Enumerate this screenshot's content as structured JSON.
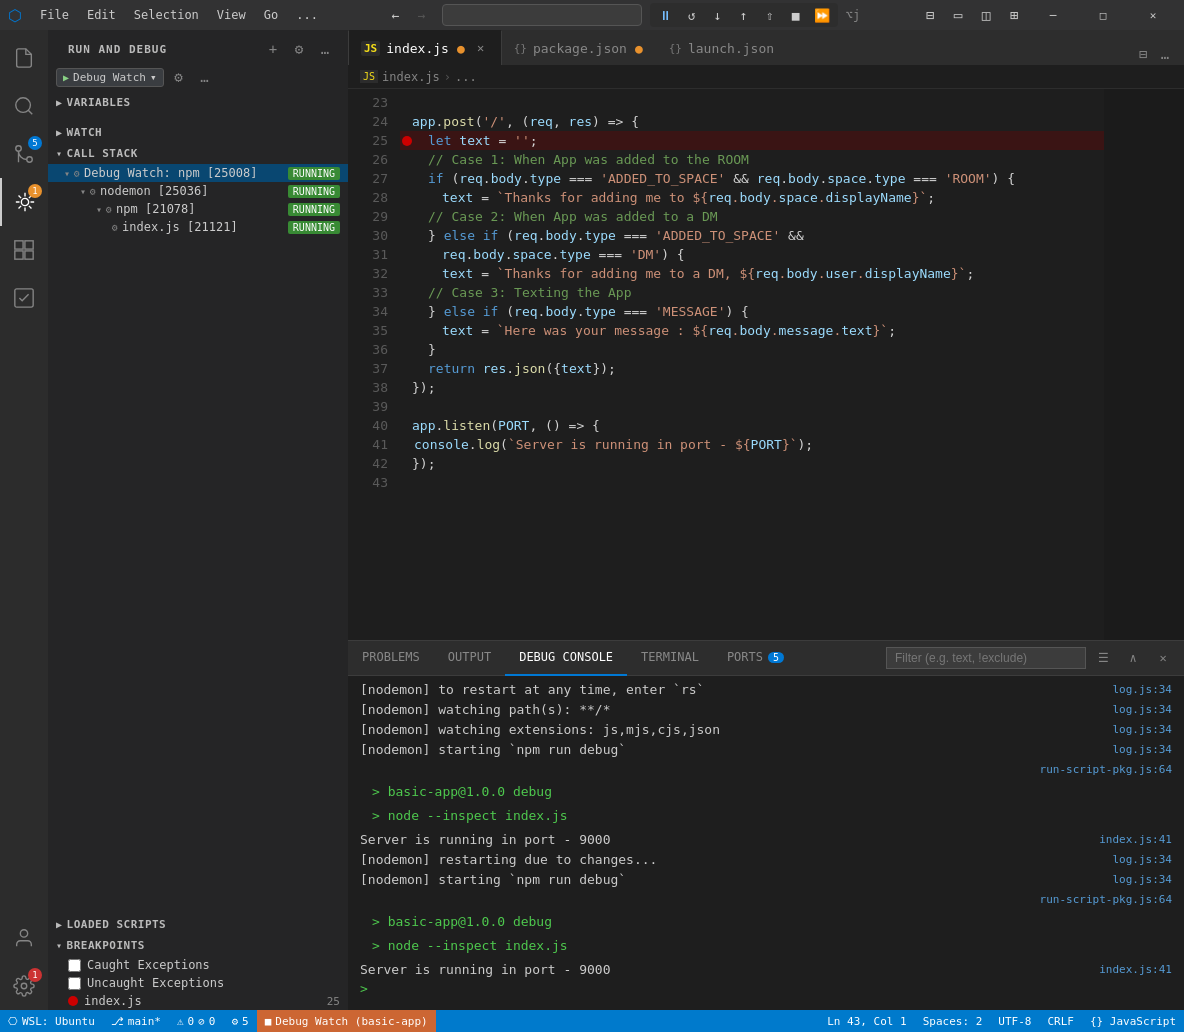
{
  "titlebar": {
    "menu_items": [
      "File",
      "Edit",
      "Selection",
      "View",
      "Go",
      "..."
    ],
    "search_placeholder": "",
    "window_buttons": [
      "─",
      "□",
      "✕"
    ],
    "debug_controls": [
      "⏸",
      "↻",
      "↓",
      "↑",
      "↺",
      "⬛",
      "⏩"
    ]
  },
  "activity_bar": {
    "icons": [
      {
        "name": "explorer",
        "symbol": "⎘",
        "active": false
      },
      {
        "name": "search",
        "symbol": "🔍",
        "active": false
      },
      {
        "name": "source-control",
        "symbol": "⎇",
        "badge": "5",
        "badge_color": "blue"
      },
      {
        "name": "debug",
        "symbol": "🐛",
        "active": true,
        "badge": "1",
        "badge_color": "orange"
      },
      {
        "name": "extensions",
        "symbol": "⊞",
        "active": false
      },
      {
        "name": "remote-explorer",
        "symbol": "⧉",
        "active": false
      }
    ],
    "bottom_icons": [
      {
        "name": "accounts",
        "symbol": "👤"
      },
      {
        "name": "settings",
        "symbol": "⚙",
        "badge": "1",
        "badge_color": "red"
      }
    ]
  },
  "sidebar": {
    "title": "RUN AND DEBUG",
    "debug_config": "Debug Watch",
    "sections": {
      "variables": {
        "label": "VARIABLES",
        "expanded": false
      },
      "watch": {
        "label": "WATCH",
        "expanded": false
      },
      "call_stack": {
        "label": "CALL STACK",
        "expanded": true,
        "items": [
          {
            "label": "Debug Watch: npm [25008]",
            "status": "RUNNING",
            "selected": true,
            "children": [
              {
                "label": "nodemon [25036]",
                "status": "RUNNING",
                "children": [
                  {
                    "label": "npm [21078]",
                    "status": "RUNNING",
                    "children": [
                      {
                        "label": "index.js [21121]",
                        "status": "RUNNING"
                      }
                    ]
                  }
                ]
              }
            ]
          }
        ]
      },
      "loaded_scripts": {
        "label": "LOADED SCRIPTS",
        "expanded": false
      },
      "breakpoints": {
        "label": "BREAKPOINTS",
        "expanded": true,
        "items": [
          {
            "label": "Caught Exceptions",
            "checked": false
          },
          {
            "label": "Uncaught Exceptions",
            "checked": false
          },
          {
            "label": "index.js",
            "checked": true,
            "has_dot": true,
            "line": "25"
          }
        ]
      }
    }
  },
  "editor": {
    "tabs": [
      {
        "label": "index.js",
        "type": "js",
        "active": true,
        "modified": true,
        "closeable": true
      },
      {
        "label": "package.json",
        "type": "json",
        "active": false,
        "modified": true,
        "closeable": false
      },
      {
        "label": "launch.json",
        "type": "json",
        "active": false,
        "modified": false,
        "closeable": false
      }
    ],
    "breadcrumb": [
      "JS index.js",
      ">",
      "..."
    ],
    "lines": [
      {
        "num": "23",
        "code": "",
        "class": ""
      },
      {
        "num": "24",
        "html": "<span class='c-variable'>app</span><span class='c-plain'>.</span><span class='c-function'>post</span><span class='c-plain'>(</span><span class='c-string'>'/'</span><span class='c-plain'>, (</span><span class='c-variable'>req</span><span class='c-plain'>, </span><span class='c-variable'>res</span><span class='c-plain'>) =&gt; {</span>"
      },
      {
        "num": "25",
        "html": "  <span class='c-keyword'>let</span> <span class='c-variable'>text</span> <span class='c-operator'>=</span> <span class='c-string'>''</span><span class='c-plain'>;</span>",
        "breakpoint": true
      },
      {
        "num": "26",
        "html": "    <span class='c-comment'>// Case 1: When App was added to the ROOM</span>"
      },
      {
        "num": "27",
        "html": "    <span class='c-keyword'>if</span> <span class='c-plain'>(</span><span class='c-variable'>req</span><span class='c-plain'>.</span><span class='c-prop'>body</span><span class='c-plain'>.</span><span class='c-prop'>type</span> <span class='c-operator'>===</span> <span class='c-string'>'ADDED_TO_SPACE'</span> <span class='c-operator'>&amp;&amp;</span> <span class='c-variable'>req</span><span class='c-plain'>.</span><span class='c-prop'>body</span><span class='c-plain'>.</span><span class='c-prop'>space</span><span class='c-plain'>.</span><span class='c-prop'>type</span> <span class='c-operator'>===</span> <span class='c-string'>'ROOM'</span><span class='c-plain'>) {</span>"
      },
      {
        "num": "28",
        "html": "      <span class='c-variable'>text</span> <span class='c-operator'>=</span> <span class='c-template'>`Thanks for adding me to $&#123;<span class='c-variable'>req</span>.<span class='c-prop'>body</span>.<span class='c-prop'>space</span>.<span class='c-prop'>displayName</span>&#125;`</span><span class='c-plain'>;</span>"
      },
      {
        "num": "29",
        "html": "    <span class='c-comment'>// Case 2: When App was added to a DM</span>"
      },
      {
        "num": "30",
        "html": "    <span class='c-plain'>&#125; </span><span class='c-keyword'>else if</span> <span class='c-plain'>(</span><span class='c-variable'>req</span><span class='c-plain'>.</span><span class='c-prop'>body</span><span class='c-plain'>.</span><span class='c-prop'>type</span> <span class='c-operator'>===</span> <span class='c-string'>'ADDED_TO_SPACE'</span> <span class='c-operator'>&amp;&amp;</span>"
      },
      {
        "num": "31",
        "html": "      <span class='c-variable'>req</span><span class='c-plain'>.</span><span class='c-prop'>body</span><span class='c-plain'>.</span><span class='c-prop'>space</span><span class='c-plain'>.</span><span class='c-prop'>type</span> <span class='c-operator'>===</span> <span class='c-string'>'DM'</span><span class='c-plain'>) {</span>"
      },
      {
        "num": "32",
        "html": "      <span class='c-variable'>text</span> <span class='c-operator'>=</span> <span class='c-template'>`Thanks for adding me to a DM, $&#123;<span class='c-variable'>req</span>.<span class='c-prop'>body</span>.<span class='c-prop'>user</span>.<span class='c-prop'>displayName</span>&#125;`</span><span class='c-plain'>;</span>"
      },
      {
        "num": "33",
        "html": "    <span class='c-comment'>// Case 3: Texting the App</span>"
      },
      {
        "num": "34",
        "html": "    <span class='c-plain'>&#125; </span><span class='c-keyword'>else if</span> <span class='c-plain'>(</span><span class='c-variable'>req</span><span class='c-plain'>.</span><span class='c-prop'>body</span><span class='c-plain'>.</span><span class='c-prop'>type</span> <span class='c-operator'>===</span> <span class='c-string'>'MESSAGE'</span><span class='c-plain'>) {</span>"
      },
      {
        "num": "35",
        "html": "      <span class='c-variable'>text</span> <span class='c-operator'>=</span> <span class='c-template'>`Here was your message : $&#123;<span class='c-variable'>req</span>.<span class='c-prop'>body</span>.<span class='c-prop'>message</span>.<span class='c-prop'>text</span>&#125;`</span><span class='c-plain'>;</span>"
      },
      {
        "num": "36",
        "html": "    <span class='c-plain'>&#125;</span>"
      },
      {
        "num": "37",
        "html": "    <span class='c-keyword'>return</span> <span class='c-variable'>res</span><span class='c-plain'>.</span><span class='c-function'>json</span><span class='c-plain'>(&#123;</span><span class='c-variable'>text</span><span class='c-plain'>&#125;);</span>"
      },
      {
        "num": "38",
        "html": "<span class='c-plain'>&#125;);</span>"
      },
      {
        "num": "39",
        "html": ""
      },
      {
        "num": "40",
        "html": "<span class='c-variable'>app</span><span class='c-plain'>.</span><span class='c-function'>listen</span><span class='c-plain'>(</span><span class='c-variable'>PORT</span><span class='c-plain'>, () =&gt; {</span>"
      },
      {
        "num": "41",
        "html": "  <span class='c-variable'>console</span><span class='c-plain'>.</span><span class='c-function'>log</span><span class='c-plain'>(</span><span class='c-template'>`Server is running in port - $&#123;<span class='c-variable'>PORT</span>&#125;`</span><span class='c-plain'>);</span>"
      },
      {
        "num": "42",
        "html": "<span class='c-plain'>&#125;);</span>"
      },
      {
        "num": "43",
        "html": ""
      }
    ]
  },
  "bottom_panel": {
    "tabs": [
      "PROBLEMS",
      "OUTPUT",
      "DEBUG CONSOLE",
      "TERMINAL",
      "PORTS"
    ],
    "active_tab": "DEBUG CONSOLE",
    "ports_badge": "5",
    "filter_placeholder": "Filter (e.g. text, !exclude)",
    "console_lines": [
      {
        "text": "[nodemon] to restart at any time, enter `rs`",
        "link": "log.js:34",
        "type": "normal"
      },
      {
        "text": "[nodemon] watching path(s): **/*",
        "link": "log.js:34",
        "type": "normal"
      },
      {
        "text": "[nodemon] watching extensions: js,mjs,cjs,json",
        "link": "log.js:34",
        "type": "normal"
      },
      {
        "text": "[nodemon] starting `npm run debug`",
        "link": "log.js:34",
        "type": "normal"
      },
      {
        "text": "",
        "link": "run-script-pkg.js:64",
        "type": "normal"
      },
      {
        "text": "> basic-app@1.0.0 debug",
        "link": "",
        "type": "green"
      },
      {
        "text": "> node --inspect index.js",
        "link": "",
        "type": "green"
      },
      {
        "text": "",
        "link": "",
        "type": "normal"
      },
      {
        "text": "Server is running in port - 9000",
        "link": "index.js:41",
        "type": "normal"
      },
      {
        "text": "[nodemon] restarting due to changes...",
        "link": "log.js:34",
        "type": "normal"
      },
      {
        "text": "[nodemon] starting `npm run debug`",
        "link": "log.js:34",
        "type": "normal"
      },
      {
        "text": "",
        "link": "run-script-pkg.js:64",
        "type": "normal"
      },
      {
        "text": "> basic-app@1.0.0 debug",
        "link": "",
        "type": "green"
      },
      {
        "text": "> node --inspect index.js",
        "link": "",
        "type": "green"
      },
      {
        "text": "",
        "link": "",
        "type": "normal"
      },
      {
        "text": "Server is running in port - 9000",
        "link": "index.js:41",
        "type": "normal"
      }
    ]
  },
  "status_bar": {
    "left_items": [
      {
        "label": "⎔ WSL: Ubuntu",
        "type": "wsl"
      },
      {
        "label": "⎇ main*",
        "type": "git"
      },
      {
        "label": "⚠ 0  ⊘ 0",
        "type": "errors"
      },
      {
        "label": "⚙ 5",
        "type": "debug"
      },
      {
        "label": "⬛ Debug Watch (basic-app)",
        "type": "debug-session"
      }
    ],
    "right_items": [
      {
        "label": "Ln 43, Col 1"
      },
      {
        "label": "Spaces: 2"
      },
      {
        "label": "UTF-8"
      },
      {
        "label": "CRLF"
      },
      {
        "label": "{} JavaScript"
      }
    ]
  }
}
